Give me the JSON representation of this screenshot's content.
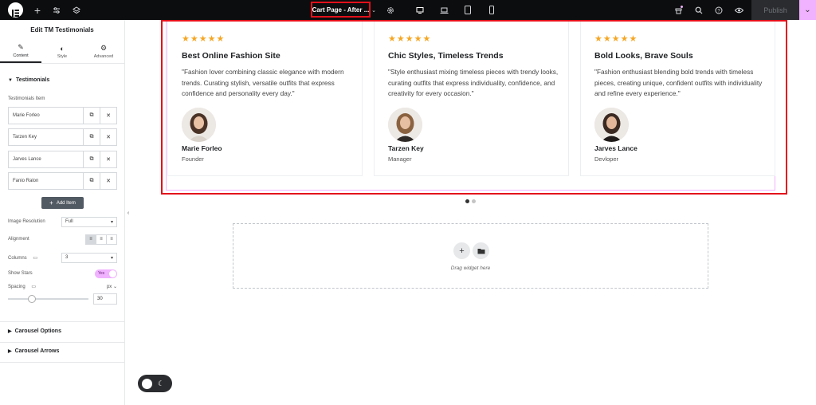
{
  "topbar": {
    "page_label": "Cart Page - After ...",
    "publish_label": "Publish"
  },
  "panel": {
    "title": "Edit TM Testimonials",
    "tabs": [
      {
        "label": "Content",
        "icon": "pencil-icon"
      },
      {
        "label": "Style",
        "icon": "contrast-icon"
      },
      {
        "label": "Advanced",
        "icon": "gear-icon"
      }
    ],
    "section_testimonials": "Testimonials",
    "items_label": "Testimonials Item",
    "items": [
      "Marie Forleo",
      "Tarzen Key",
      "Jarves Lance",
      "Fanio Ralon"
    ],
    "add_item": "Add Item",
    "image_resolution_label": "Image Resolution",
    "image_resolution_value": "Full",
    "alignment_label": "Alignment",
    "columns_label": "Columns",
    "columns_value": "3",
    "show_stars_label": "Show Stars",
    "show_stars_value": "Yes",
    "spacing_label": "Spacing",
    "spacing_unit": "px",
    "spacing_value": "30",
    "spacing_fraction": 0.3,
    "section_carousel_options": "Carousel Options",
    "section_carousel_arrows": "Carousel Arrows"
  },
  "testimonials": [
    {
      "stars": "★★★★★",
      "title": "Best Online Fashion Site",
      "quote": "\"Fashion lover combining classic elegance with modern trends. Curating stylish, versatile outfits that express confidence and personality every day.\"",
      "name": "Marie Forleo",
      "role": "Founder"
    },
    {
      "stars": "★★★★★",
      "title": "Chic Styles, Timeless Trends",
      "quote": "\"Style enthusiast mixing timeless pieces with trendy looks, curating outfits that express individuality, confidence, and creativity for every occasion.\"",
      "name": "Tarzen Key",
      "role": "Manager"
    },
    {
      "stars": "★★★★★",
      "title": "Bold Looks, Brave Souls",
      "quote": "\"Fashion enthusiast blending bold trends with timeless pieces, creating unique, confident outfits with individuality and refine every experience.\"",
      "name": "Jarves Lance",
      "role": "Devloper"
    }
  ],
  "dropzone": {
    "text": "Drag widget here"
  },
  "colors": {
    "accent_pink": "#f0b1ff",
    "highlight_red": "#e3101a",
    "star": "#f5a623",
    "topbar_bg": "#0c0d0e"
  }
}
